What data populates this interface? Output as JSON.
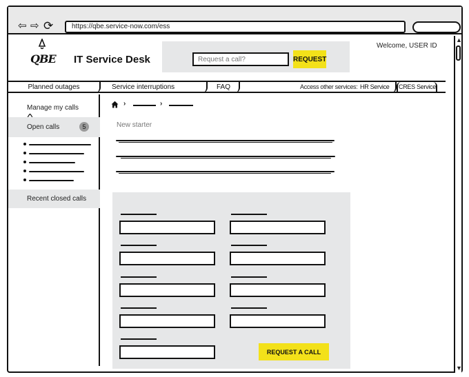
{
  "browser": {
    "url": "https://qbe.service-now.com/ess",
    "back_glyph": "⇦",
    "forward_glyph": "⇨",
    "reload_glyph": "⟳"
  },
  "header": {
    "logo_text": "QBE",
    "logo_bell_glyph": "🔔",
    "title": "IT Service Desk",
    "search_placeholder": "Request a call?",
    "request_label": "REQUEST",
    "welcome": "Welcome, USER ID"
  },
  "nav": {
    "tabs": [
      "Planned outages",
      "Service interruptions",
      "FAQ"
    ],
    "access_label": "Access other services:",
    "other_services": [
      "HR Service",
      "CRES Service"
    ]
  },
  "sidebar": {
    "title": "Manage my calls",
    "open_calls_label": "Open calls",
    "open_calls_count": "5",
    "recent_label": "Recent closed calls"
  },
  "breadcrumb": {
    "home_icon": "home-icon",
    "separator": "›"
  },
  "main": {
    "page_title": "New starter"
  },
  "form": {
    "submit_label": "REQUEST A CALL"
  },
  "colors": {
    "accent_yellow": "#f3e11a",
    "panel_gray": "#e6e7e8",
    "badge_gray": "#9b9b9b"
  }
}
